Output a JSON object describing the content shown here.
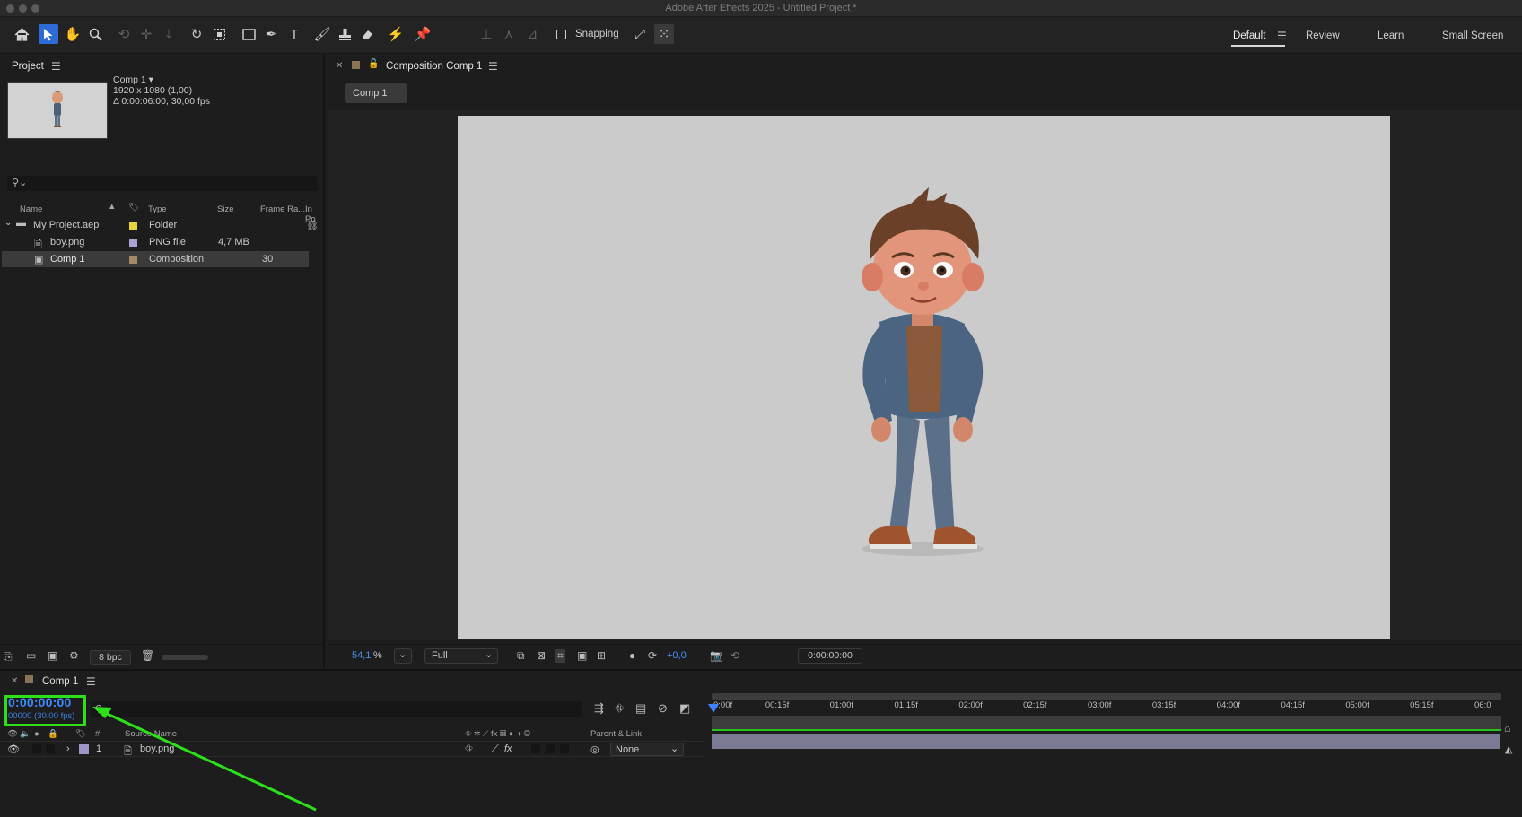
{
  "app": {
    "window_title": "Adobe After Effects 2025 - Untitled Project *"
  },
  "toolbar": {
    "snapping_label": "Snapping",
    "workspaces": [
      "Default",
      "Review",
      "Learn",
      "Small Screen"
    ]
  },
  "project": {
    "panel_title": "Project",
    "comp_name": "Comp 1 ▾",
    "comp_resolution": "1920 x 1080 (1,00)",
    "comp_duration": "Δ 0:00:06:00, 30,00 fps",
    "columns": {
      "name": "Name",
      "type": "Type",
      "size": "Size",
      "frame_rate": "Frame Ra...",
      "in_point": "In Po"
    },
    "items": [
      {
        "name": "My Project.aep",
        "type": "Folder",
        "size": "",
        "frame_rate": "",
        "color": "#e6d23a"
      },
      {
        "name": "boy.png",
        "type": "PNG file",
        "size": "4,7 MB",
        "frame_rate": "",
        "color": "#a9a0d4"
      },
      {
        "name": "Comp 1",
        "type": "Composition",
        "size": "",
        "frame_rate": "30",
        "color": "#a38a65"
      }
    ],
    "bit_depth": "8 bpc"
  },
  "composition": {
    "panel_title": "Composition Comp 1",
    "subtab": "Comp 1",
    "zoom_value": "54,1",
    "zoom_unit": "%",
    "resolution": "Full",
    "exposure": "+0,0",
    "current_time": "0:00:00:00"
  },
  "timeline": {
    "tab": "Comp 1",
    "time": "0:00:00:00",
    "frames": "00000 (30.00 fps)",
    "col_number": "#",
    "col_source_name": "Source Name",
    "col_parent": "Parent & Link",
    "layer": {
      "index": "1",
      "name": "boy.png",
      "parent": "None",
      "label_color": "#9d97c8"
    },
    "ticks": [
      "0:00f",
      "00:15f",
      "01:00f",
      "01:15f",
      "02:00f",
      "02:15f",
      "03:00f",
      "03:15f",
      "04:00f",
      "04:15f",
      "05:00f",
      "05:15f",
      "06:0"
    ]
  },
  "colors": {
    "accent_blue": "#2d6cd6",
    "timecode_blue": "#3d8bff",
    "annotation_green": "#2de01a",
    "canvas_gray": "#cbcbcb",
    "layer_bar": "#7a7a94"
  }
}
